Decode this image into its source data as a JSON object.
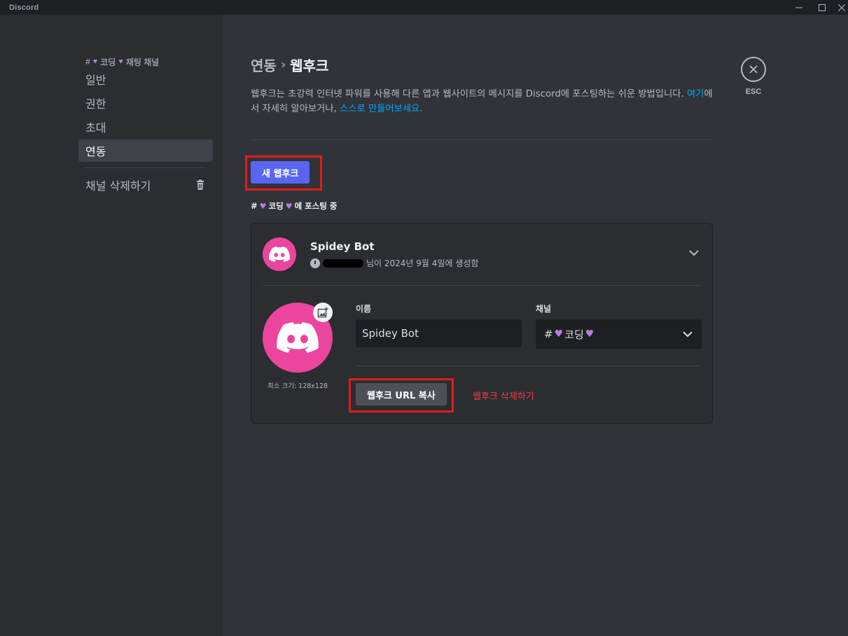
{
  "titlebar": {
    "app_name": "Discord",
    "minimize_icon": "minimize-icon",
    "maximize_icon": "maximize-icon",
    "close_icon": "close-icon"
  },
  "sidebar": {
    "header": {
      "hash": "#",
      "name_a": "코딩",
      "name_b": "채팅 채널"
    },
    "items": [
      {
        "label": "일반",
        "active": false
      },
      {
        "label": "권한",
        "active": false
      },
      {
        "label": "초대",
        "active": false
      },
      {
        "label": "연동",
        "active": true
      }
    ],
    "delete_channel": "채널 삭제하기"
  },
  "main": {
    "breadcrumb_parent": "연동",
    "breadcrumb_sep": "›",
    "breadcrumb_current": "웹후크",
    "desc_part1": "웹후크는 초강력 인터넷 파워를 사용해 다른 앱과 웹사이트의 메시지를 Discord에 포스팅하는 쉬운 방법입니다. ",
    "desc_link1": "여기",
    "desc_part2": "에서 자세히 알아보거나, ",
    "desc_link2": "스스로 만들어보세요.",
    "new_webhook": "새 웹후크",
    "posting_hash": "#",
    "posting_channel": "코딩",
    "posting_suffix": "에 포스팅 중"
  },
  "webhook": {
    "name": "Spidey Bot",
    "created": "님이 2024년 9월 4일에 생성함",
    "min_size": "최소 크기: 128x128",
    "name_label": "이름",
    "name_value": "Spidey Bot",
    "channel_label": "채널",
    "channel_hash": "#",
    "channel_name": "코딩",
    "copy_url": "웹후크 URL 복사",
    "delete": "웹후크 삭제하기"
  },
  "close": {
    "label": "ESC"
  },
  "colors": {
    "accent": "#5865f2",
    "avatar": "#eb459e",
    "danger": "#f23f43",
    "link": "#00a8fc",
    "annotation": "#e21b1b"
  }
}
